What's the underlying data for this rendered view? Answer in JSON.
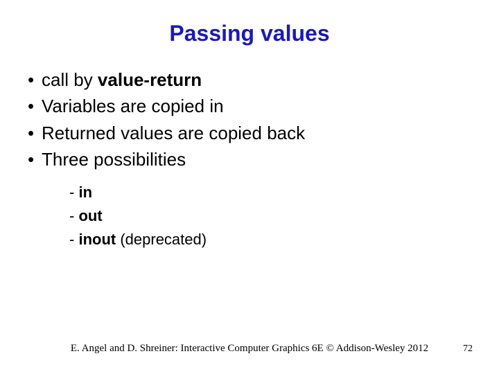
{
  "title": "Passing values",
  "bullets": {
    "b1_pre": "call by ",
    "b1_bold": "value-return",
    "b2": "Variables are copied in",
    "b3": "Returned values are copied back",
    "b4": "Three possibilities"
  },
  "sub": {
    "s1_bold": "in",
    "s2_bold": "out",
    "s3_bold": "inout",
    "s3_rest": " (deprecated)"
  },
  "footer": "E. Angel and D. Shreiner: Interactive Computer Graphics 6E © Addison-Wesley 2012",
  "page": "72"
}
